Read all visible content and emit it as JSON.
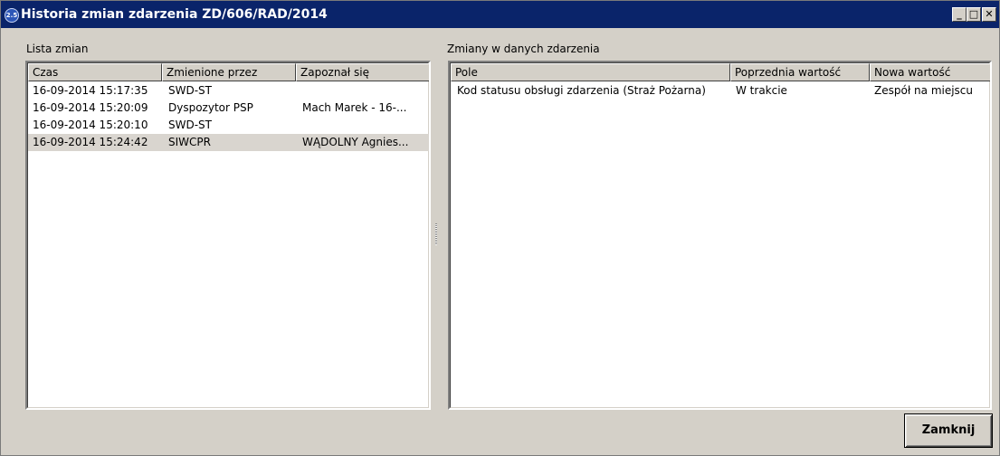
{
  "window": {
    "title": "Historia zmian zdarzenia ZD/606/RAD/2014",
    "icon_label": "2.5",
    "controls": {
      "minimize": "_",
      "maximize": "□",
      "close": "✕"
    }
  },
  "left_panel": {
    "label": "Lista zmian",
    "columns": [
      "Czas",
      "Zmienione przez",
      "Zapoznał się"
    ],
    "rows": [
      {
        "czas": "16-09-2014 15:17:35",
        "zmienione_przez": "SWD-ST",
        "zapoznal_sie": ""
      },
      {
        "czas": "16-09-2014 15:20:09",
        "zmienione_przez": "Dyspozytor PSP",
        "zapoznal_sie": "Mach Marek - 16-..."
      },
      {
        "czas": "16-09-2014 15:20:10",
        "zmienione_przez": "SWD-ST",
        "zapoznal_sie": ""
      },
      {
        "czas": "16-09-2014 15:24:42",
        "zmienione_przez": "SIWCPR",
        "zapoznal_sie": "WĄDOLNY Agnies..."
      }
    ],
    "selected_row_index": 3
  },
  "right_panel": {
    "label": "Zmiany w danych zdarzenia",
    "columns": [
      "Pole",
      "Poprzednia wartość",
      "Nowa wartość"
    ],
    "rows": [
      {
        "pole": "Kod statusu obsługi zdarzenia (Straż Pożarna)",
        "poprzednia": "W trakcie",
        "nowa": "Zespół na miejscu"
      }
    ]
  },
  "buttons": {
    "close": "Zamknij"
  },
  "colors": {
    "titlebar": "#0a246a",
    "face": "#d4d0c8",
    "selected_row": "#d9d5cf"
  }
}
